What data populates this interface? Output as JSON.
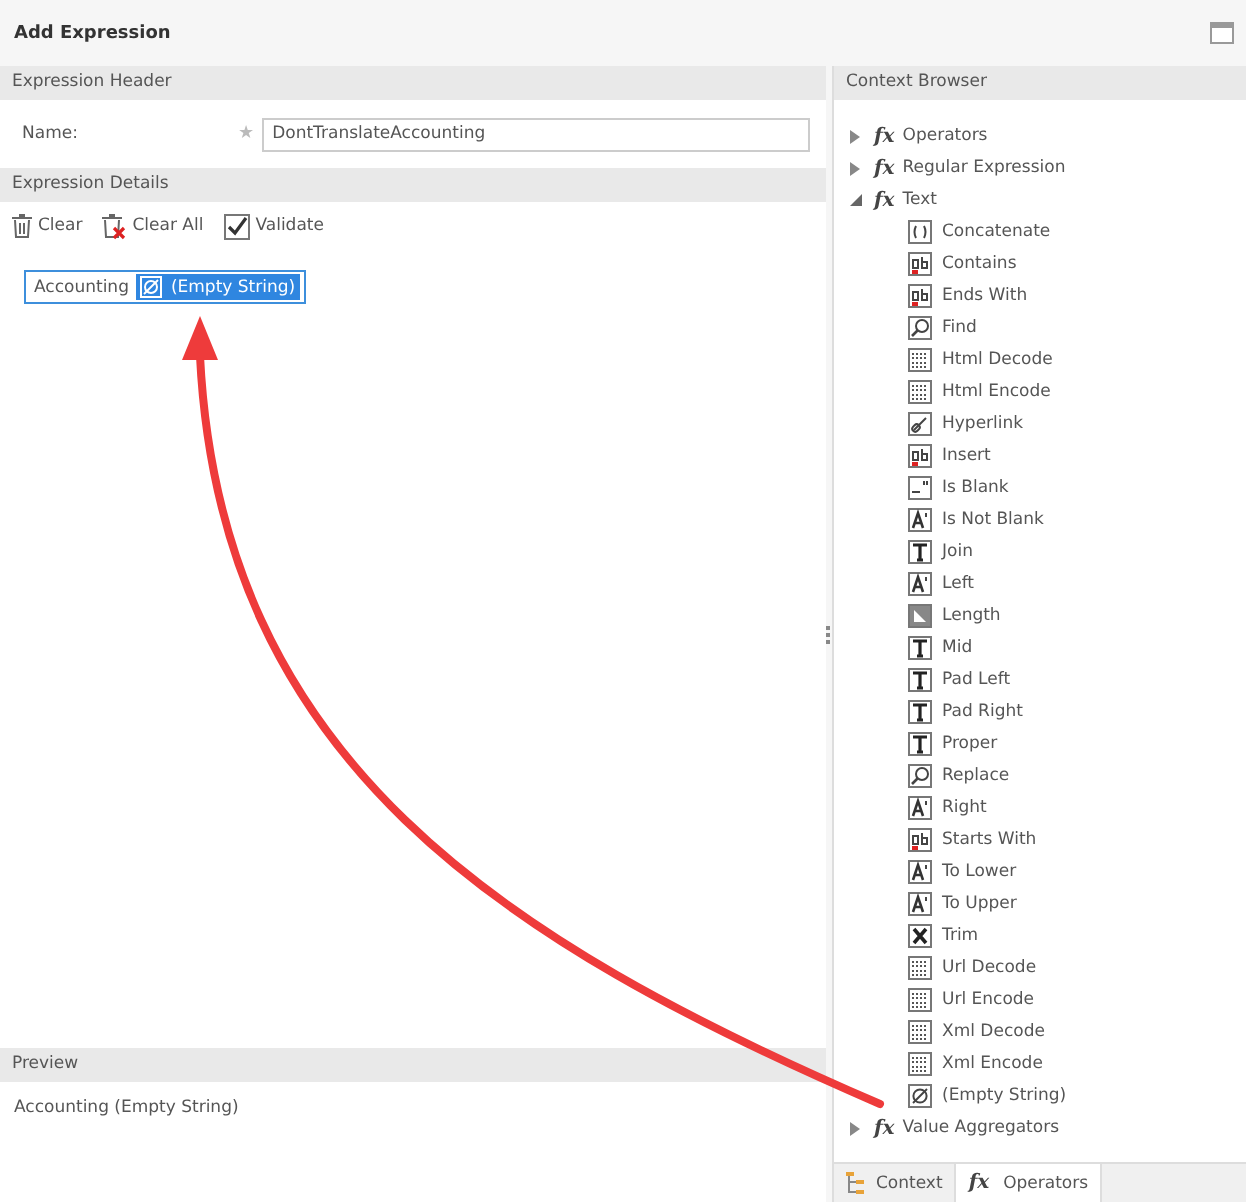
{
  "window": {
    "title": "Add Expression"
  },
  "expression_header": {
    "title": "Expression Header",
    "name_label": "Name:",
    "required_mark": "★",
    "name_value": "DontTranslateAccounting"
  },
  "expression_details": {
    "title": "Expression Details",
    "toolbar": [
      {
        "kind": "clear",
        "label": "Clear"
      },
      {
        "kind": "clearall",
        "label": "Clear All"
      },
      {
        "kind": "validate",
        "label": "Validate",
        "checked": true
      }
    ],
    "tokens": [
      {
        "kind": "text",
        "label": "Accounting",
        "selected": false
      },
      {
        "kind": "function",
        "label": "(Empty String)",
        "selected": true
      }
    ]
  },
  "preview": {
    "title": "Preview",
    "text": "Accounting (Empty String)"
  },
  "context_browser": {
    "title": "Context Browser",
    "tree": [
      {
        "icon_text": "fx",
        "label": "Operators",
        "expanded": false
      },
      {
        "icon_text": "fx",
        "label": "Regular Expression",
        "expanded": false
      },
      {
        "icon_text": "fx",
        "label": "Text",
        "expanded": true,
        "children": [
          {
            "label": "Concatenate",
            "kind": "code"
          },
          {
            "label": "Contains",
            "kind": "ab"
          },
          {
            "label": "Ends With",
            "kind": "ab"
          },
          {
            "label": "Find",
            "kind": "find"
          },
          {
            "label": "Html Decode",
            "kind": "binary"
          },
          {
            "label": "Html Encode",
            "kind": "binary"
          },
          {
            "label": "Hyperlink",
            "kind": "link"
          },
          {
            "label": "Insert",
            "kind": "ab"
          },
          {
            "label": "Is Blank",
            "kind": "blank"
          },
          {
            "label": "Is Not Blank",
            "kind": "letter"
          },
          {
            "label": "Join",
            "kind": "typeface"
          },
          {
            "label": "Left",
            "kind": "letter"
          },
          {
            "label": "Length",
            "kind": "length"
          },
          {
            "label": "Mid",
            "kind": "typeface"
          },
          {
            "label": "Pad Left",
            "kind": "typeface"
          },
          {
            "label": "Pad Right",
            "kind": "typeface"
          },
          {
            "label": "Proper",
            "kind": "typeface"
          },
          {
            "label": "Replace",
            "kind": "find"
          },
          {
            "label": "Right",
            "kind": "letter"
          },
          {
            "label": "Starts With",
            "kind": "ab"
          },
          {
            "label": "To Lower",
            "kind": "letter"
          },
          {
            "label": "To Upper",
            "kind": "letter"
          },
          {
            "label": "Trim",
            "kind": "trim"
          },
          {
            "label": "Url Decode",
            "kind": "binary"
          },
          {
            "label": "Url Encode",
            "kind": "binary"
          },
          {
            "label": "Xml Decode",
            "kind": "binary"
          },
          {
            "label": "Xml Encode",
            "kind": "binary"
          },
          {
            "label": "(Empty String)",
            "kind": "empty"
          }
        ]
      },
      {
        "icon_text": "fx",
        "label": "Value Aggregators",
        "expanded": false
      }
    ],
    "tabs": [
      {
        "kind": "context",
        "label": "Context",
        "selected": false
      },
      {
        "kind": "operators",
        "icon_text": "fx",
        "label": "Operators",
        "selected": true
      }
    ]
  }
}
